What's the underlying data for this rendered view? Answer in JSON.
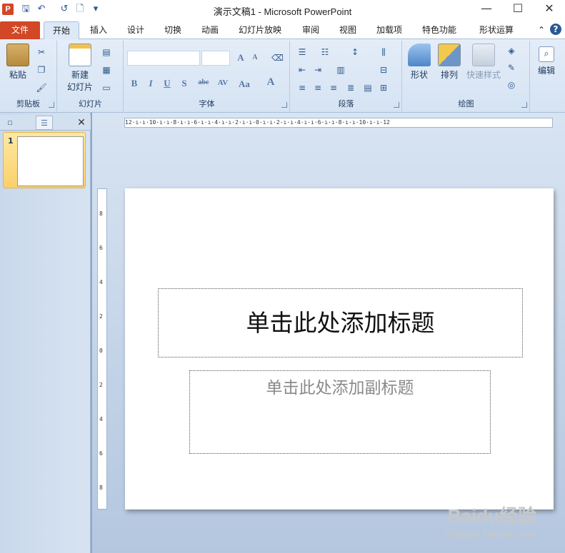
{
  "window": {
    "title": "演示文稿1 - Microsoft PowerPoint",
    "logo_letter": "P",
    "minimize": "—",
    "maximize": "☐",
    "close": "✕"
  },
  "quick_access": {
    "save": "🖫",
    "undo": "↶",
    "redo": "↺",
    "new": "🗋",
    "customize": "▾"
  },
  "tabs": [
    {
      "label": "文件"
    },
    {
      "label": "开始"
    },
    {
      "label": "插入"
    },
    {
      "label": "设计"
    },
    {
      "label": "切换"
    },
    {
      "label": "动画"
    },
    {
      "label": "幻灯片放映"
    },
    {
      "label": "审阅"
    },
    {
      "label": "视图"
    },
    {
      "label": "加载项"
    },
    {
      "label": "特色功能"
    },
    {
      "label": "形状运算"
    }
  ],
  "tab_right": {
    "collapse": "⌃",
    "help": "?"
  },
  "ribbon": {
    "clipboard": {
      "label": "剪贴板",
      "paste": "粘贴"
    },
    "slides": {
      "label": "幻灯片",
      "new_slide_line1": "新建",
      "new_slide_line2": "幻灯片"
    },
    "font": {
      "label": "字体",
      "bold": "B",
      "italic": "I",
      "underline": "U",
      "shadow": "S",
      "strike": "abc",
      "spacing": "AV",
      "case": "Aa",
      "color": "A",
      "grow": "A",
      "shrink": "A"
    },
    "paragraph": {
      "label": "段落"
    },
    "drawing": {
      "label": "绘图",
      "shapes": "形状",
      "arrange": "排列",
      "quick_styles": "快速样式"
    },
    "editing": {
      "label": "编辑"
    }
  },
  "thumbnails": {
    "slide_number": "1",
    "close": "✕"
  },
  "ruler": {
    "horizontal": "12·ı·ı·10·ı·ı·8·ı·ı·6·ı·ı·4·ı·ı·2·ı·ı·0·ı·ı·2·ı·ı·4·ı·ı·6·ı·ı·8·ı·ı·10·ı·ı·12",
    "vertical_labels": [
      "8",
      "6",
      "4",
      "2",
      "0",
      "2",
      "4",
      "6",
      "8"
    ]
  },
  "slide": {
    "title_placeholder": "单击此处添加标题",
    "subtitle_placeholder": "单击此处添加副标题"
  },
  "watermark": {
    "brand": "Baidu经验",
    "url": "jingyan.baidu.com"
  },
  "colors": {
    "file_tab": "#d24726",
    "ribbon": "#dde9f7",
    "accent": "#2a5a95"
  }
}
